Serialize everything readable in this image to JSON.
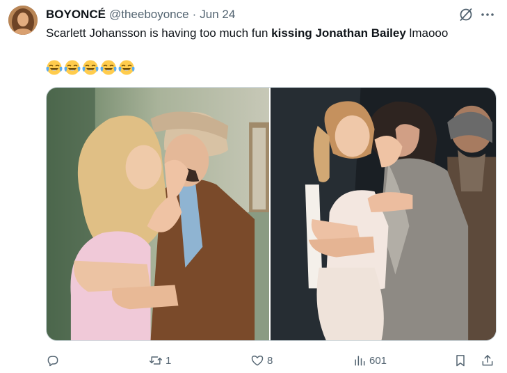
{
  "tweet": {
    "display_name": "BOYONCÉ",
    "handle": "@theeboyonce",
    "separator": "·",
    "date": "Jun 24",
    "text_part1": "Scarlett Johansson is having too much fun ",
    "text_bold": "kissing Jonathan Bailey",
    "text_part2": " lmaooo",
    "emoji_count": 5,
    "emoji_name": "face-with-tears-of-joy"
  },
  "media": {
    "photos": [
      {
        "description_icon": "photo-couple-kiss-left"
      },
      {
        "description_icon": "photo-couple-kiss-right"
      }
    ]
  },
  "actions": {
    "reply_count": "",
    "retweet_count": "1",
    "like_count": "8",
    "views_count": "601"
  },
  "colors": {
    "text": "#0f1419",
    "secondary": "#536471",
    "border": "#cfd9de"
  }
}
